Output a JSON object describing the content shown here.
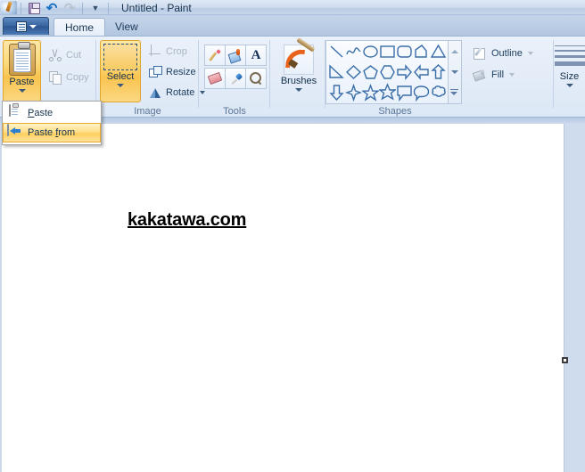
{
  "window": {
    "title": "Untitled - Paint",
    "app_icon": "paint-icon"
  },
  "quick_access": {
    "save": "Save",
    "undo": "Undo",
    "redo": "Redo",
    "customize": "Customize Quick Access Toolbar"
  },
  "tabs": {
    "file_button": "File",
    "items": [
      {
        "label": "Home",
        "active": true
      },
      {
        "label": "View",
        "active": false
      }
    ]
  },
  "ribbon": {
    "groups": [
      {
        "label": ""
      },
      {
        "label": "Image"
      },
      {
        "label": "Tools"
      },
      {
        "label": ""
      },
      {
        "label": "Shapes"
      },
      {
        "label": "Size"
      }
    ],
    "clipboard": {
      "paste_label": "Paste",
      "cut_label": "Cut",
      "copy_label": "Copy",
      "cut_disabled": true,
      "copy_disabled": true
    },
    "image": {
      "select_label": "Select",
      "crop_label": "Crop",
      "resize_label": "Resize",
      "rotate_label": "Rotate",
      "crop_disabled": true
    },
    "tools": {
      "items": [
        "pencil-tool",
        "fill-tool",
        "text-tool",
        "eraser-tool",
        "color-picker-tool",
        "magnifier-tool"
      ]
    },
    "brushes": {
      "label": "Brushes"
    },
    "shapes": {
      "row1": [
        "line",
        "curve",
        "oval",
        "rectangle",
        "rounded-rectangle",
        "polygon",
        "triangle"
      ],
      "row2": [
        "right-triangle",
        "diamond",
        "pentagon",
        "hexagon",
        "right-arrow",
        "left-arrow",
        "up-arrow"
      ],
      "row3": [
        "down-arrow",
        "four-point-star",
        "five-point-star",
        "six-point-star",
        "rectangular-callout",
        "rounded-callout",
        "cloud-callout"
      ],
      "scroll_up": "Scroll up",
      "scroll_down": "Scroll down",
      "more": "More shapes"
    },
    "outline_label": "Outline",
    "fill_label": "Fill",
    "size_label": "Size"
  },
  "paste_menu": {
    "visible": true,
    "items": [
      {
        "label_pre": "",
        "label_accel": "P",
        "label_post": "aste",
        "icon": "clipboard-icon",
        "highlighted": false
      },
      {
        "label_pre": "Paste ",
        "label_accel": "f",
        "label_post": "rom",
        "icon": "paste-from-icon",
        "highlighted": true
      }
    ]
  },
  "canvas": {
    "text": "kakatawa.com",
    "background_color": "#ffffff",
    "resize_handle": "right-middle-resize-handle"
  },
  "colors": {
    "accent_orange": "#f9c44f",
    "menu_highlight": "#fecf5e",
    "ribbon_bg": "#e2ebf7",
    "titlebar_bg": "#cfdcee",
    "workspace_bg": "#c5d4e8"
  }
}
